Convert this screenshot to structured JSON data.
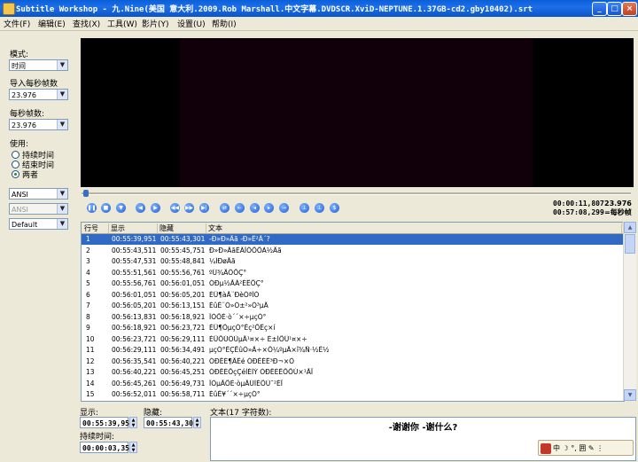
{
  "window": {
    "title": "Subtitle Workshop - 九.Nine(美国 意大利.2009.Rob Marshall.中文字幕.DVDSCR.XviD-NEPTUNE.1.37GB-cd2.gby10402).srt"
  },
  "menu": [
    {
      "label": "文件(F)"
    },
    {
      "label": "编辑(E)"
    },
    {
      "label": "查找(X)"
    },
    {
      "label": "工具(W)"
    },
    {
      "label": "影片(Y)"
    },
    {
      "label": "设置(U)"
    },
    {
      "label": "帮助(I)"
    }
  ],
  "left": {
    "mode_label": "模式:",
    "mode_value": "时间",
    "input_fps_label": "导入每秒帧数",
    "input_fps_value": "23.976",
    "fps_label": "每秒帧数:",
    "fps_value": "23.976",
    "use_label": "使用:",
    "radios": [
      {
        "label": "持续时间",
        "checked": false
      },
      {
        "label": "结束时间",
        "checked": false
      },
      {
        "label": "两者",
        "checked": true
      }
    ],
    "charset1": "ANSI",
    "charset2": "ANSI",
    "format": "Default"
  },
  "player": {
    "current_time": "00:00:11,807",
    "total_time": "00:57:08,299",
    "fps": "23.976",
    "fps_unit": "=每秒帧",
    "seek_fraction": 0.0034
  },
  "table": {
    "headers": [
      "行号",
      "显示",
      "隐藏",
      "文本"
    ],
    "rows": [
      {
        "n": "1",
        "show": "00:55:39,951",
        "hide": "00:55:43,301",
        "text": "-Ð»Ð»Äã -Ð»Ê²Ã´?"
      },
      {
        "n": "2",
        "show": "00:55:43,511",
        "hide": "00:55:45,751",
        "text": "Ð»Ð»ÄãÊÂÎÔÕÕÀ½Äã"
      },
      {
        "n": "3",
        "show": "00:55:47,531",
        "hide": "00:55:48,841",
        "text": "¼ÍÐøÄã"
      },
      {
        "n": "4",
        "show": "00:55:51,561",
        "hide": "00:55:56,761",
        "text": "ºÜ¾ÃÖÕÇ°"
      },
      {
        "n": "5",
        "show": "00:55:56,761",
        "hide": "00:56:01,051",
        "text": "ÓÐµ½ÃÀ²ÉÊÕÇ°"
      },
      {
        "n": "6",
        "show": "00:56:01,051",
        "hide": "00:56:05,201",
        "text": "ÈÛ¶àÃ¨ÐèÒªÎÒ"
      },
      {
        "n": "7",
        "show": "00:56:05,201",
        "hide": "00:56:13,151",
        "text": "ÈûÊ¨Ò»Ö±²»Ò³µÄ"
      },
      {
        "n": "8",
        "show": "00:56:13,831",
        "hide": "00:56:18,921",
        "text": "ÎÒÕÉ·ò´´×÷µçÓ°"
      },
      {
        "n": "9",
        "show": "00:56:18,921",
        "hide": "00:56:23,721",
        "text": "ÈÛ¶ÔµçÓ°Êç²ÕÊç×í"
      },
      {
        "n": "10",
        "show": "00:56:23,721",
        "hide": "00:56:29,111",
        "text": "ÈÛÕÙÖÚµÄ¹¤×÷ É±ÌÕÜ¹¤×÷"
      },
      {
        "n": "11",
        "show": "00:56:29,111",
        "hide": "00:56:34,491",
        "text": "µçÓ°ÊÇËûÒ»Ã÷×Ô¼ºµÄ×î¾Ñ·½Ê½"
      },
      {
        "n": "12",
        "show": "00:56:35,541",
        "hide": "00:56:40,221",
        "text": "ÓÐÊÉ¶ÃÊé ÓÐÊÉÊ³Ð¬×Ó"
      },
      {
        "n": "13",
        "show": "00:56:40,221",
        "hide": "00:56:45,251",
        "text": "ÓÐÊÉÕçÇéÌÉÌÝ ÓÐÊÉÊÕÕÚ×¹ÃÏ"
      },
      {
        "n": "14",
        "show": "00:56:45,261",
        "hide": "00:56:49,731",
        "text": "ÎÒµÃÕÉ·òµÄÜÌÈÕÚ¯²ÉÏ"
      },
      {
        "n": "15",
        "show": "00:56:52,011",
        "hide": "00:56:58,711",
        "text": "ÈûÊ¥´´×÷µçÓ°"
      }
    ]
  },
  "edit": {
    "show_label": "显示:",
    "show_value": "00:55:39,951",
    "hide_label": "隐藏:",
    "hide_value": "00:55:43,301",
    "duration_label": "持续时间:",
    "duration_value": "00:00:03,350",
    "text_label": "文本(17 字符数):",
    "text_value": "-谢谢你 -谢什么?"
  },
  "ime": {
    "label": "中 ☽ °, 囲 ✎ ⋮"
  }
}
